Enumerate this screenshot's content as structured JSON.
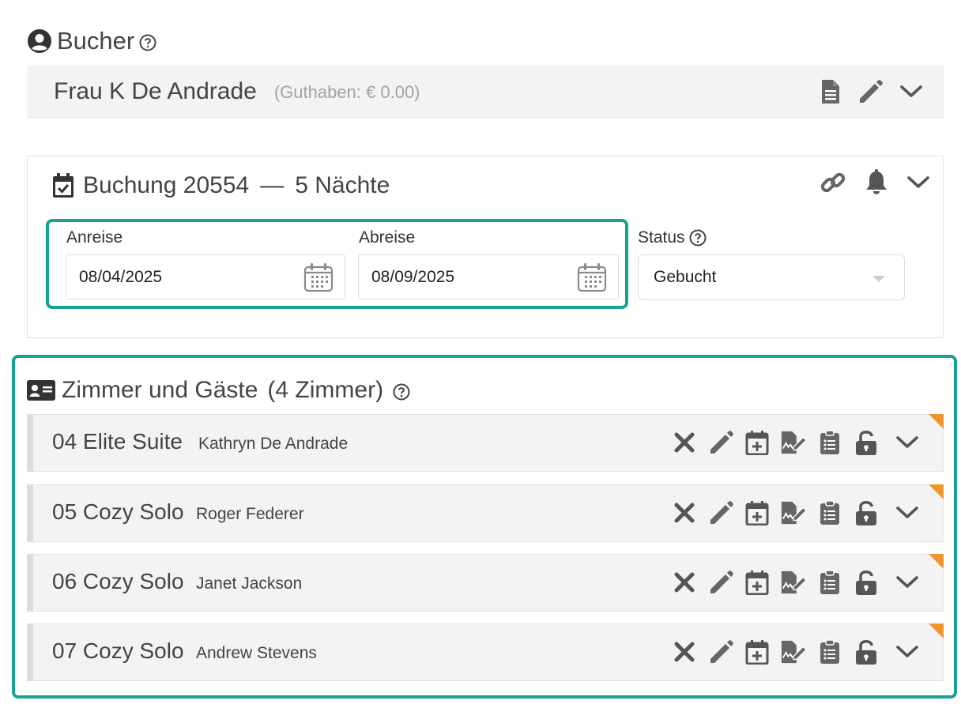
{
  "booker": {
    "heading": "Bucher",
    "name": "Frau K De Andrade",
    "credit": "(Guthaben: € 0.00)",
    "icons": [
      "person-circle-icon",
      "help-icon",
      "document-icon",
      "pencil-icon",
      "chevron-down-icon"
    ]
  },
  "booking": {
    "title": "Buchung 20554",
    "dash": "—",
    "nights": "5 Nächte",
    "icons": [
      "calendar-check-icon",
      "link-icon",
      "bell-icon",
      "chevron-down-icon"
    ],
    "arrival_label": "Anreise",
    "arrival_value": "08/04/2025",
    "departure_label": "Abreise",
    "departure_value": "08/09/2025",
    "status_label": "Status",
    "status_value": "Gebucht"
  },
  "rooms": {
    "heading": "Zimmer und Gäste",
    "count": "(4 Zimmer)",
    "items": [
      {
        "name": "04 Elite Suite",
        "guest": "Kathryn De Andrade"
      },
      {
        "name": "05 Cozy Solo",
        "guest": "Roger Federer"
      },
      {
        "name": "06 Cozy Solo",
        "guest": "Janet Jackson"
      },
      {
        "name": "07 Cozy Solo",
        "guest": "Andrew Stevens"
      }
    ],
    "row_icons": [
      "close-icon",
      "pencil-icon",
      "calendar-plus-icon",
      "signature-icon",
      "clipboard-list-icon",
      "unlock-icon",
      "chevron-down-icon"
    ]
  },
  "colors": {
    "accent_frame": "#16a393",
    "corner_marker": "#f0952b",
    "icon": "#666666",
    "row_background": "#f3f3f3"
  }
}
